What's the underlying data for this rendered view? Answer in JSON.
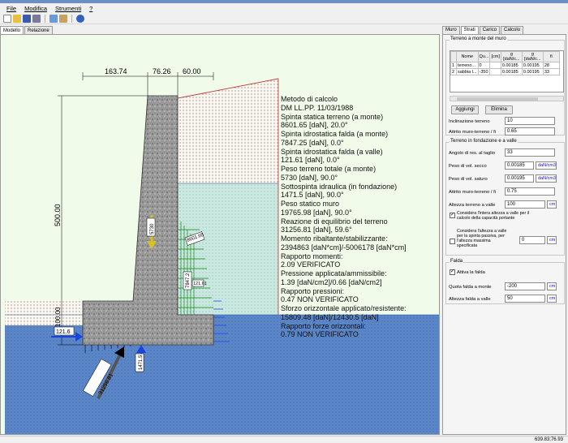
{
  "menu": [
    "File",
    "Modifica",
    "Strumenti",
    "?"
  ],
  "toolbar": {
    "icons": [
      "new-icon",
      "open-icon",
      "save-icon",
      "print-icon",
      "copy-icon",
      "paste-icon",
      "info-icon"
    ]
  },
  "doc_tabs": [
    "Modello",
    "Relazione"
  ],
  "drawing": {
    "dim_top": [
      "163.74",
      "76.26",
      "60.00"
    ],
    "dim_left": "500.00",
    "dim_base": "100.00",
    "force_labels": {
      "f1": "121.6",
      "f2": "31256.81",
      "f3": "1471.5",
      "f4": "8601.65",
      "f5": "7847.2",
      "f6": "121.61",
      "f7": "5730"
    }
  },
  "results": [
    "Metodo di calcolo",
    "DM LL.PP. 11/03/1988",
    "Spinta statica terreno (a monte)",
    "8601.65 [daN], 20.0°",
    "Spinta idrostatica falda (a monte)",
    "7847.25 [daN], 0.0°",
    "Spinta idrostatica falda (a valle)",
    "121.61 [daN], 0.0°",
    "Peso terreno totale (a monte)",
    "5730 [daN], 90.0°",
    "Sottospinta idraulica (in fondazione)",
    "1471.5 [daN], 90.0°",
    "Peso statico muro",
    "19765.98 [daN], 90.0°",
    "Reazione di equilibrio del terreno",
    "31256.81 [daN], 59.6°",
    "Momento ribaltante/stabilizzante:",
    "2394863 [daN*cm]/-5006178 [daN*cm]",
    "Rapporto momenti:",
    "2.09 VERIFICATO",
    "Pressione applicata/ammissibile:",
    "1.39 [daN/cm2]/0.66 [daN/cm2]",
    "Rapporto pressioni:",
    "0.47 NON VERIFICATO",
    "Sforzo orizzontale applicato/resistente:",
    "15809.48 [daN]/12430.5 [daN]",
    "Rapporto forze orizzontali:",
    "0.79 NON VERIFICATO"
  ],
  "panel": {
    "tabs": [
      "Muro",
      "Strati",
      "Carico",
      "Calcolo"
    ],
    "active_tab": "Strati",
    "terreno_monte": {
      "title": "Terreno a monte del muro",
      "columns": [
        "",
        "Nome",
        "Qu...",
        "[cm]",
        "g [daN/c...",
        "g [daN/c...",
        "fi"
      ],
      "rows": [
        [
          "1",
          "terreno...",
          "0",
          "",
          "0.00185",
          "0.00195",
          "28"
        ],
        [
          "2",
          "sabbia l...",
          "-350",
          "",
          "0.00185",
          "0.00195",
          "33"
        ]
      ],
      "add_label": "Aggiungi",
      "delete_label": "Elimina",
      "inclinazione_label": "Inclinazione terreno",
      "inclinazione_value": "10",
      "attrito_label": "Attrito muro-terreno / fi",
      "attrito_value": "0.65"
    },
    "terreno_fondazione": {
      "title": "Terreno in fondazione e a valle",
      "angolo_label": "Angolo di res. al taglio",
      "angolo_value": "33",
      "peso_secco_label": "Peso di vol. secco",
      "peso_secco_value": "0.00185",
      "peso_secco_unit": "daN/cm3",
      "peso_saturo_label": "Peso di vol. saturo",
      "peso_saturo_value": "0.00195",
      "peso_saturo_unit": "daN/cm3",
      "attrito_label": "Attrito muro-terreno / fi",
      "attrito_value": "0.75",
      "altezza_label": "Altezza terreno a valle",
      "altezza_value": "100",
      "altezza_unit": "cm",
      "check1_label_a": "Considera l'intera altezza a valle per il",
      "check1_label_b": "calcolo della capacità portante",
      "check1_checked": true,
      "check2_label_a": "Considera l'altezza a valle",
      "check2_label_b": "per la spinta passiva, per",
      "check2_label_c": "l'altezza massima",
      "check2_label_d": "specificata",
      "check2_checked": false,
      "check2_value": "0",
      "check2_unit": "cm"
    },
    "falda": {
      "title": "Falda",
      "attiva_label": "Attiva la falda",
      "attiva_checked": true,
      "quota_label": "Quota falda a monte",
      "quota_value": "-200",
      "quota_unit": "cm",
      "altezza_label": "Altezza falda a valle",
      "altezza_value": "50",
      "altezza_unit": "cm"
    }
  },
  "status": {
    "coords": "639.83;76.93"
  },
  "colors": {
    "canvas_bg": "#f0fbea",
    "water": "#5a86c8",
    "wall": "#8a8a8a",
    "soil_hatch": "#c04040",
    "force_arrow": "#1a44e0",
    "pressure_green": "#1a8a1a"
  }
}
